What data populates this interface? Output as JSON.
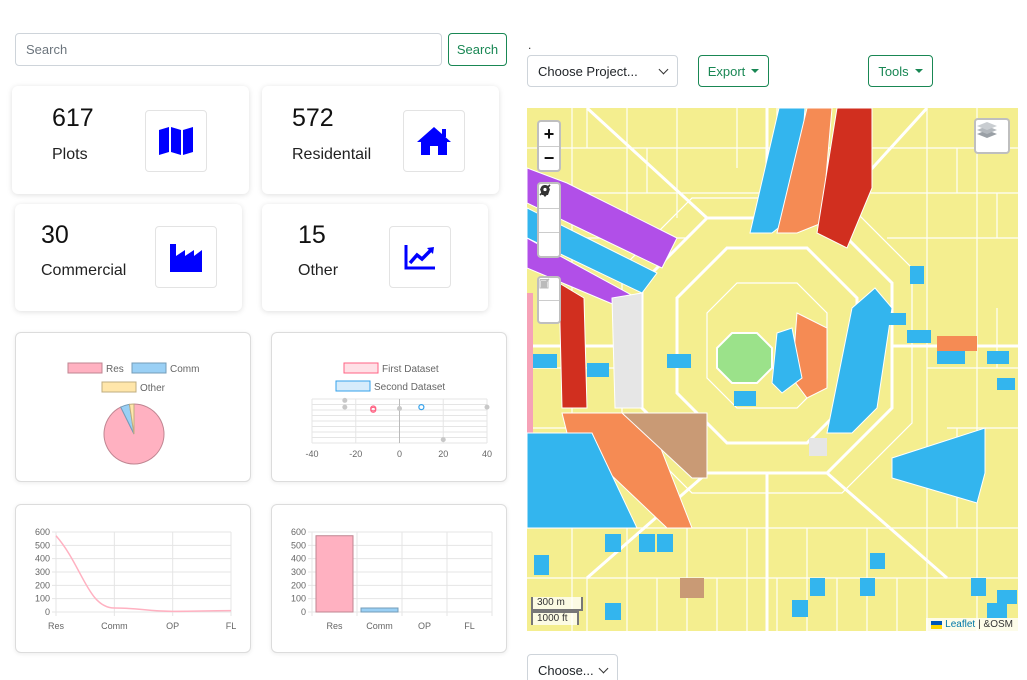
{
  "search": {
    "placeholder": "Search",
    "value": "",
    "button_label": "Search"
  },
  "stats": [
    {
      "count": "617",
      "label": "Plots",
      "icon": "map-icon"
    },
    {
      "count": "572",
      "label": "Residentail",
      "icon": "home-icon"
    },
    {
      "count": "30",
      "label": "Commercial",
      "icon": "industry-icon"
    },
    {
      "count": "15",
      "label": "Other",
      "icon": "chart-line-icon"
    }
  ],
  "toolbar": {
    "dot": ".",
    "project_select": "Choose Project...",
    "export_label": "Export",
    "tools_label": "Tools"
  },
  "bottom_select": "Choose...",
  "map": {
    "zoom_in": "+",
    "zoom_out": "−",
    "scale_m": "300 m",
    "scale_ft": "1000 ft",
    "attribution_link": "Leaflet",
    "attribution_rest": "| &OSM"
  },
  "colors": {
    "accent": "#198754",
    "icon_blue": "#0000ff",
    "residential": "#f4ee8f",
    "commercial_blue": "#33b5ee",
    "orange": "#f58b54",
    "red": "#d12f1f",
    "purple": "#b14fe8",
    "tan": "#c99a75",
    "green": "#9be28a"
  },
  "chart_data": [
    {
      "type": "pie",
      "categories": [
        "Res",
        "Comm",
        "Other"
      ],
      "values": [
        572,
        30,
        15
      ],
      "colors": [
        "#ffb1c1",
        "#9ad0f5",
        "#ffe6aa"
      ],
      "legend_position": "top"
    },
    {
      "type": "scatter",
      "series": [
        {
          "name": "First Dataset",
          "points": [
            [
              -12,
              6
            ],
            [
              -12,
              4
            ]
          ],
          "color": "#ff6384"
        },
        {
          "name": "Second Dataset",
          "points": [
            [
              10,
              8
            ]
          ],
          "color": "#36a2eb"
        }
      ],
      "extra_points": [
        [
          -25,
          18
        ],
        [
          -25,
          8
        ],
        [
          0,
          6
        ],
        [
          40,
          8
        ],
        [
          20,
          -40
        ]
      ],
      "xticks": [
        "-40",
        "-20",
        "0",
        "20",
        "40"
      ],
      "xlim": [
        -40,
        40
      ],
      "ylim": [
        -45,
        20
      ],
      "legend_position": "top"
    },
    {
      "type": "line",
      "categories": [
        "Res",
        "Comm",
        "OP",
        "FL"
      ],
      "values": [
        572,
        30,
        5,
        10
      ],
      "yticks": [
        "0",
        "100",
        "200",
        "300",
        "400",
        "500",
        "600"
      ],
      "ylim": [
        0,
        600
      ],
      "color": "#ffb1c1",
      "grid": true
    },
    {
      "type": "bar",
      "categories": [
        "Res",
        "Comm",
        "OP",
        "FL"
      ],
      "values": [
        572,
        30,
        0,
        0
      ],
      "colors": [
        "#ffb1c1",
        "#9ad0f5",
        "#ffe6aa",
        "#a5dfdf"
      ],
      "yticks": [
        "0",
        "100",
        "200",
        "300",
        "400",
        "500",
        "600"
      ],
      "ylim": [
        0,
        600
      ],
      "grid": true
    }
  ]
}
